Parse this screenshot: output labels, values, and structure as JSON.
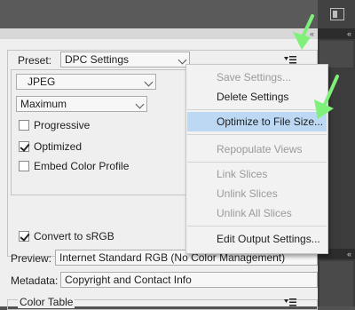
{
  "preset": {
    "label": "Preset:",
    "value": "DPC Settings"
  },
  "format": {
    "value": "JPEG"
  },
  "quality": {
    "value": "Maximum"
  },
  "options": [
    {
      "label": "Progressive",
      "checked": false
    },
    {
      "label": "Optimized",
      "checked": true
    },
    {
      "label": "Embed Color Profile",
      "checked": false
    }
  ],
  "convert": {
    "label": "Convert to sRGB",
    "checked": true
  },
  "preview": {
    "label": "Preview:",
    "value": "Internet Standard RGB (No Color Management)"
  },
  "metadata": {
    "label": "Metadata:",
    "value": "Copyright and Contact Info"
  },
  "color_table": {
    "label": "Color Table"
  },
  "menu": {
    "items": [
      {
        "label": "Save Settings...",
        "enabled": false
      },
      {
        "label": "Delete Settings",
        "enabled": true
      },
      {
        "label": "Optimize to File Size...",
        "enabled": true,
        "highlighted": true
      },
      {
        "label": "Repopulate Views",
        "enabled": false
      },
      {
        "label": "Link Slices",
        "enabled": false
      },
      {
        "label": "Unlink Slices",
        "enabled": false
      },
      {
        "label": "Unlink All Slices",
        "enabled": false
      },
      {
        "label": "Edit Output Settings...",
        "enabled": true
      }
    ]
  },
  "collapse_glyph": "«",
  "colors": {
    "highlight": "#bcd8f3",
    "annotation_arrow": "#7ff07a"
  },
  "icons": [
    "panel-icon",
    "menu-icon",
    "collapse-icon",
    "chevron-down-icon",
    "checkbox-icon",
    "annotation-arrow"
  ]
}
